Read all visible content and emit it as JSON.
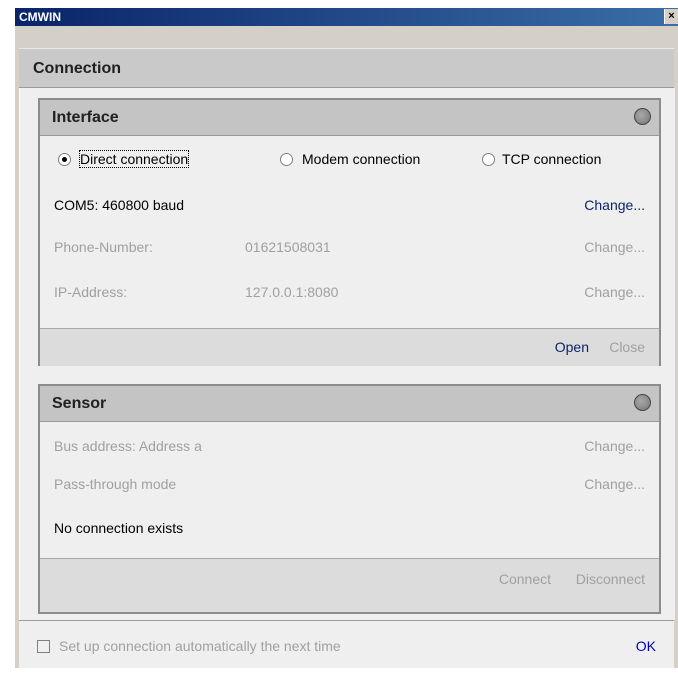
{
  "window": {
    "title": "CMWIN",
    "close_glyph": "×"
  },
  "header": {
    "title": "Connection"
  },
  "interface": {
    "title": "Interface",
    "status_icon": "status-led-icon",
    "radios": [
      {
        "label": "Direct connection",
        "checked": true
      },
      {
        "label": "Modem connection",
        "checked": false
      },
      {
        "label": "TCP connection",
        "checked": false
      }
    ],
    "com": {
      "label": "COM5: 460800 baud",
      "change": "Change..."
    },
    "phone": {
      "label": "Phone-Number:",
      "value": "01621508031",
      "change": "Change..."
    },
    "ip": {
      "label": "IP-Address:",
      "value": "127.0.0.1:8080",
      "change": "Change..."
    },
    "open": "Open",
    "close": "Close"
  },
  "sensor": {
    "title": "Sensor",
    "status_icon": "status-led-icon",
    "bus": {
      "label": "Bus address: Address a",
      "change": "Change..."
    },
    "pass": {
      "label": "Pass-through mode",
      "change": "Change..."
    },
    "status": "No connection exists",
    "connect": "Connect",
    "disconnect": "Disconnect"
  },
  "footer": {
    "auto_label": "Set up connection automatically the next time",
    "auto_checked": false,
    "ok": "OK"
  },
  "colors": {
    "title_bar": "#0a246a",
    "link": "#0a246a",
    "disabled_text": "#a0a0a0",
    "panel_head": "#c4c4c4"
  }
}
